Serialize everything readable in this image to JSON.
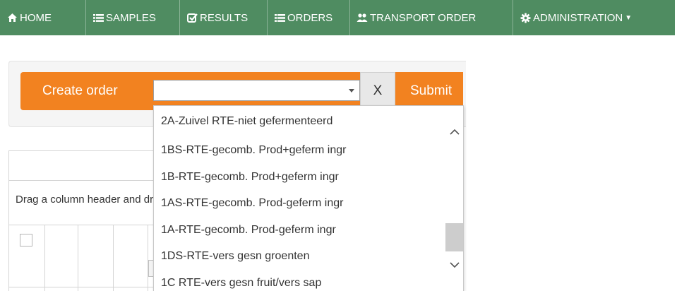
{
  "navbar": {
    "items": [
      {
        "label": "HOME",
        "icon": "home-icon"
      },
      {
        "label": "SAMPLES",
        "icon": "list-icon"
      },
      {
        "label": "RESULTS",
        "icon": "check-square-icon"
      },
      {
        "label": "ORDERS",
        "icon": "list-icon"
      },
      {
        "label": "TRANSPORT ORDER",
        "icon": "users-icon"
      },
      {
        "label": "ADMINISTRATION",
        "icon": "gear-icon"
      }
    ]
  },
  "order_bar": {
    "create_label": "Create order",
    "search_value": "",
    "clear_label": "X",
    "submit_label": "Submit"
  },
  "grid": {
    "group_hint": "Drag a column header and drop it here to group by that column"
  },
  "dropdown": {
    "options": [
      "2A-Zuivel RTE-niet gefermenteerd",
      "1BS-RTE-gecomb. Prod+geferm ingr",
      "1B-RTE-gecomb. Prod+geferm ingr",
      "1AS-RTE-gecomb. Prod-geferm ingr",
      "1A-RTE-gecomb. Prod-geferm ingr",
      "1DS-RTE-vers gesn groenten",
      "1C RTE-vers gesn fruit/vers sap"
    ]
  },
  "colors": {
    "navbar_bg": "#4f8c61",
    "accent_orange": "#f28220"
  }
}
